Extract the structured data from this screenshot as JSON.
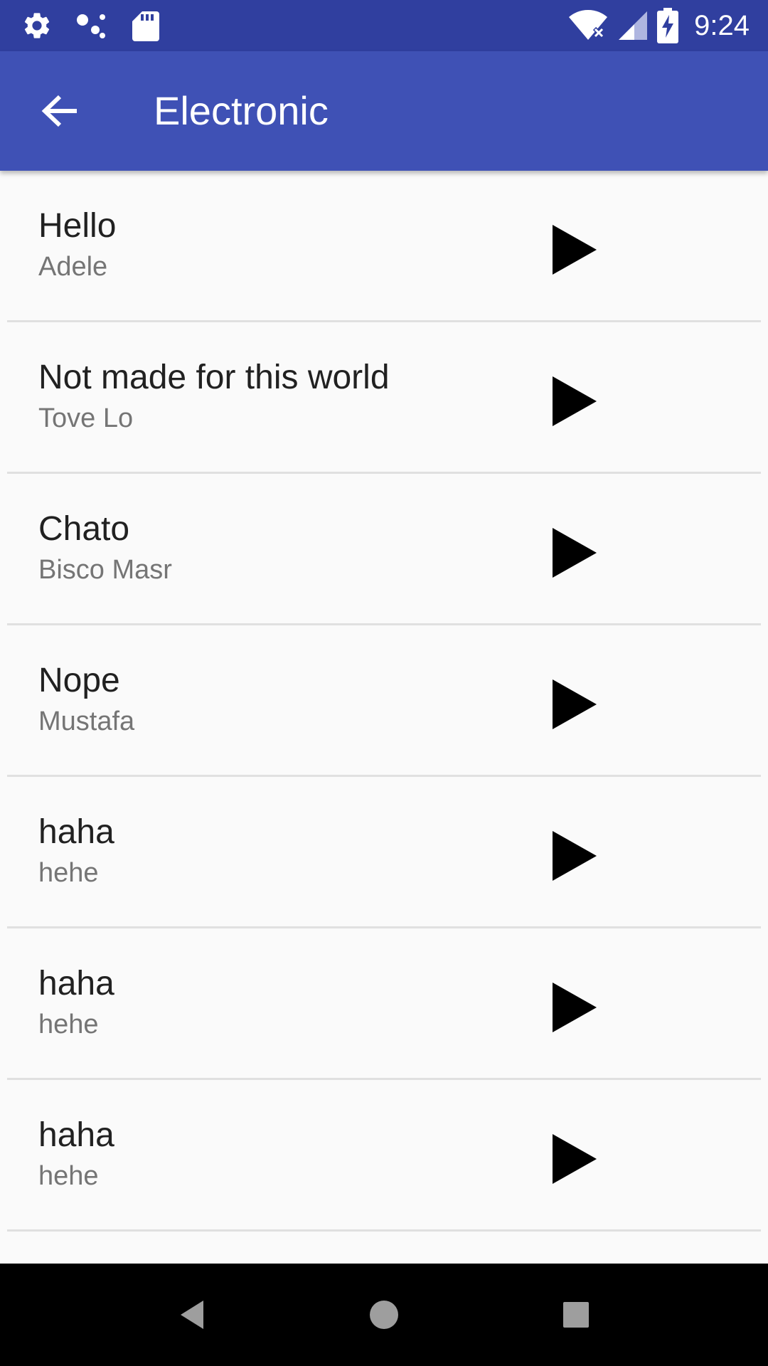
{
  "status_bar": {
    "time": "9:24",
    "icons_left": [
      "settings-icon",
      "assistant-dots-icon",
      "sd-card-icon"
    ],
    "icons_right": [
      "wifi-off-icon",
      "signal-icon",
      "battery-charging-icon"
    ]
  },
  "app_bar": {
    "title": "Electronic",
    "back_icon": "arrow-back-icon"
  },
  "songs": [
    {
      "title": "Hello",
      "artist": "Adele"
    },
    {
      "title": "Not made for this world",
      "artist": "Tove Lo"
    },
    {
      "title": "Chato",
      "artist": "Bisco Masr"
    },
    {
      "title": "Nope",
      "artist": "Mustafa"
    },
    {
      "title": "haha",
      "artist": "hehe"
    },
    {
      "title": "haha",
      "artist": "hehe"
    },
    {
      "title": "haha",
      "artist": "hehe"
    }
  ],
  "nav_bar": {
    "icons": [
      "back-triangle-icon",
      "home-circle-icon",
      "recents-square-icon"
    ]
  },
  "colors": {
    "status_bar": "#303f9f",
    "app_bar": "#3f51b5",
    "background": "#fafafa",
    "title_text": "#212121",
    "artist_text": "#757575"
  }
}
